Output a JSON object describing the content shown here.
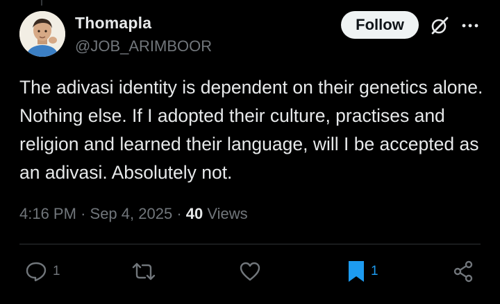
{
  "author": {
    "display_name": "Thomapla",
    "handle": "@JOB_ARIMBOOR"
  },
  "follow_label": "Follow",
  "tweet": {
    "text": "The adivasi identity is dependent on their genetics alone. Nothing else. If I adopted their culture, practises and religion and learned their language, will I be accepted as an adivasi. Absolutely not."
  },
  "meta": {
    "time": "4:16 PM",
    "date": "Sep 4, 2025",
    "views_count": "40",
    "views_label": "Views"
  },
  "actions": {
    "reply_count": "1",
    "bookmark_count": "1"
  },
  "colors": {
    "background": "#000000",
    "text": "#e7e9ea",
    "muted": "#71767b",
    "accent": "#1d9bf0",
    "follow_bg": "#eff3f4"
  },
  "icons": [
    "reply-icon",
    "retweet-icon",
    "like-icon",
    "bookmark-icon",
    "share-icon",
    "grok-icon",
    "more-icon"
  ]
}
